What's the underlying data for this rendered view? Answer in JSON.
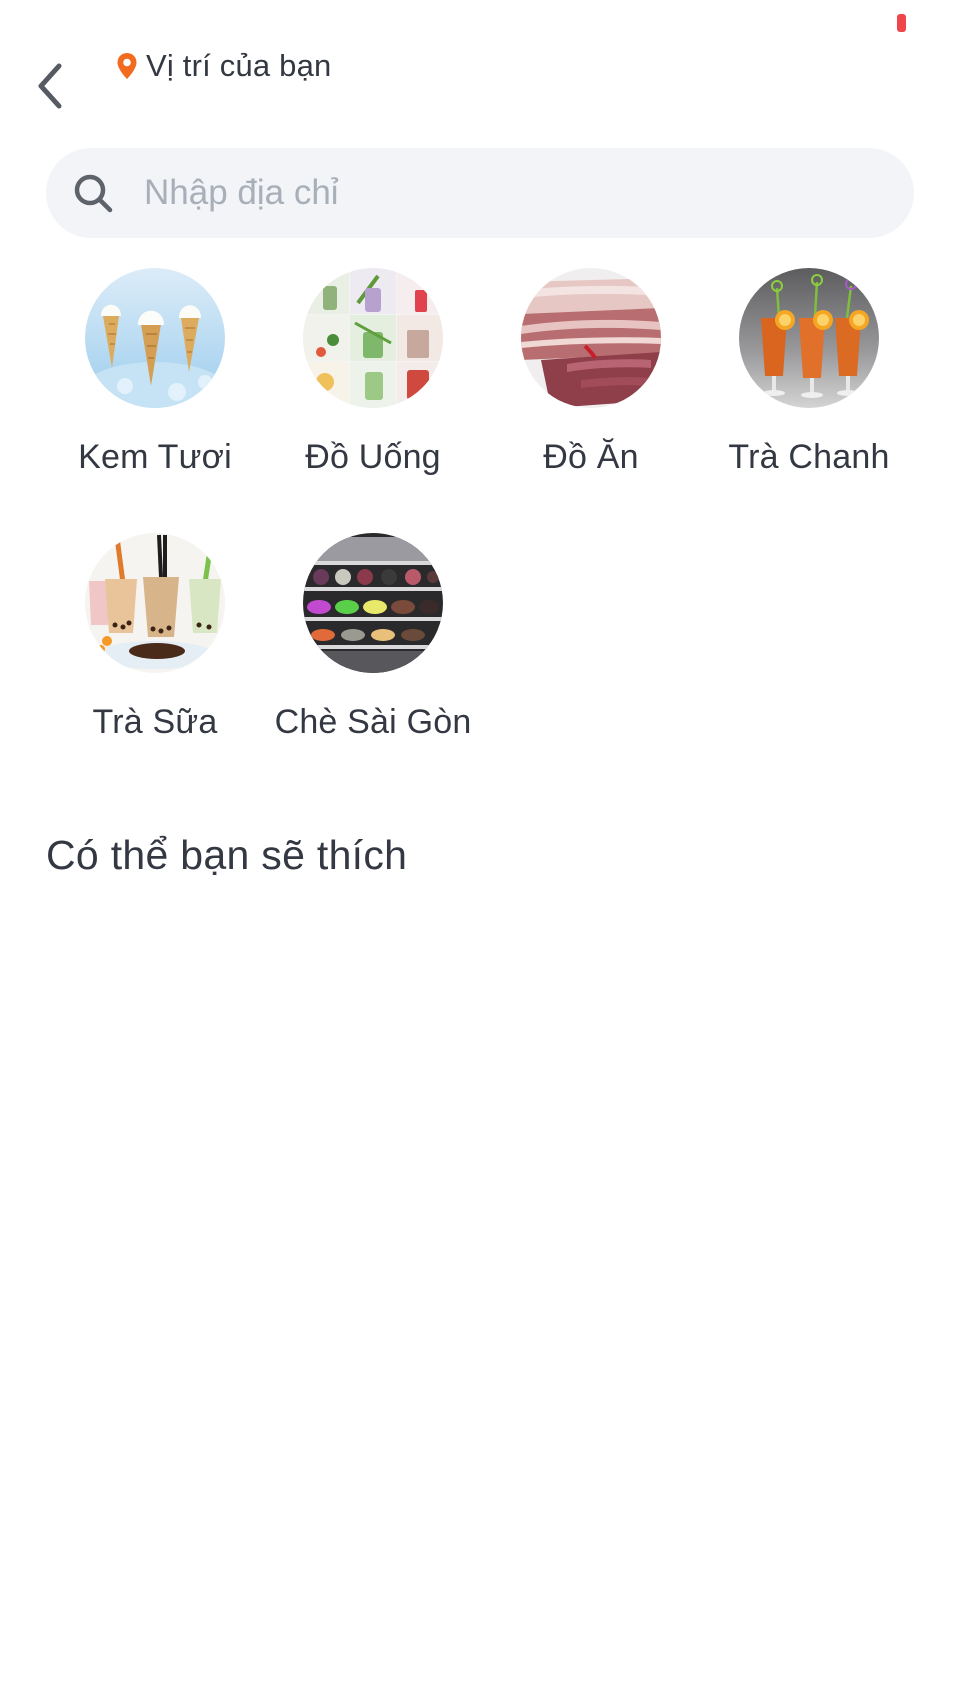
{
  "header": {
    "back_icon": "chevron-left-icon",
    "location_icon": "map-pin-icon",
    "location_label": "Vị trí của bạn",
    "accent_color": "#f26b21",
    "status_indicator_color": "#f0464b"
  },
  "search": {
    "icon": "search-icon",
    "placeholder": "Nhập địa chỉ",
    "value": ""
  },
  "categories": [
    {
      "label": "Kem Tươi",
      "image": "ice-cream-cones"
    },
    {
      "label": "Đồ Uống",
      "image": "drinks-collage"
    },
    {
      "label": "Đồ Ăn",
      "image": "raw-pork-belly"
    },
    {
      "label": "Trà Chanh",
      "image": "lemon-tea-glasses"
    },
    {
      "label": "Trà Sữa",
      "image": "bubble-milk-tea-cups"
    },
    {
      "label": "Chè Sài Gòn",
      "image": "sweet-soup-display-case"
    }
  ],
  "recommendations": {
    "title": "Có thể bạn sẽ thích",
    "items": []
  }
}
